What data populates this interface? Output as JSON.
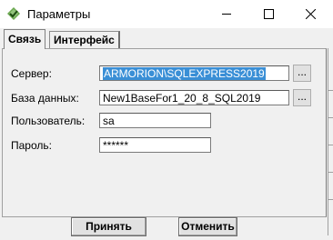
{
  "window": {
    "title": "Параметры",
    "icon": "app-diamond-icon",
    "accent": "#3a8fd6"
  },
  "tabs": [
    {
      "label": "Связь",
      "active": true
    },
    {
      "label": "Интерфейс",
      "active": false
    }
  ],
  "form": {
    "server": {
      "label": "Сервер:",
      "value": "ARMORION\\SQLEXPRESS2019",
      "browse": "..."
    },
    "database": {
      "label": "База данных:",
      "value": "New1BaseFor1_20_8_SQL2019",
      "browse": "..."
    },
    "user": {
      "label": "Пользователь:",
      "value": "sa"
    },
    "password": {
      "label": "Пароль:",
      "value": "******"
    }
  },
  "buttons": {
    "ok": "Принять",
    "cancel": "Отменить"
  }
}
